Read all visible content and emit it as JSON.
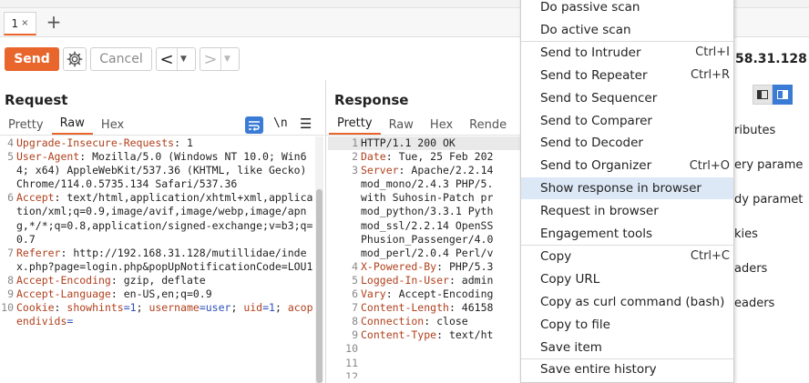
{
  "tabs": {
    "first_label": "1",
    "close_glyph": "×",
    "add_glyph": "+"
  },
  "toolbar": {
    "send_label": "Send",
    "cancel_label": "Cancel",
    "back_glyph": "<",
    "forward_glyph": ">",
    "dropdown_glyph": "▼",
    "target_host": "58.31.128"
  },
  "request": {
    "title": "Request",
    "tabs": [
      "Pretty",
      "Raw",
      "Hex"
    ],
    "active_tab": "Raw",
    "newline_toggle_label": "\\n",
    "menu_glyph": "☰",
    "lines": [
      {
        "num": "4",
        "key": "Upgrade-Insecure-Requests",
        "sep": ": ",
        "value": "1"
      },
      {
        "num": "5",
        "key": "User-Agent",
        "sep": ": ",
        "value": "Mozilla/5.0 (Windows NT 10.0; Win64; x64) AppleWebKit/537.36 (KHTML, like Gecko) Chrome/114.0.5735.134 Safari/537.36"
      },
      {
        "num": "6",
        "key": "Accept",
        "sep": ": ",
        "value": "text/html,application/xhtml+xml,application/xml;q=0.9,image/avif,image/webp,image/apng,*/*;q=0.8,application/signed-exchange;v=b3;q=0.7"
      },
      {
        "num": "7",
        "key": "Referer",
        "sep": ": ",
        "value": "http://192.168.31.128/mutillidae/index.php?page=login.php&popUpNotificationCode=LOU1"
      },
      {
        "num": "8",
        "key": "Accept-Encoding",
        "sep": ": ",
        "value": "gzip, deflate"
      },
      {
        "num": "9",
        "key": "Accept-Language",
        "sep": ": ",
        "value": "en-US,en;q=0.9"
      },
      {
        "num": "10",
        "key": "Cookie",
        "sep": ": ",
        "value": "showhints=1; username=user; uid=1; acopendivids="
      }
    ]
  },
  "response": {
    "title": "Response",
    "tabs": [
      "Pretty",
      "Raw",
      "Hex",
      "Rende"
    ],
    "active_tab": "Pretty",
    "lines": [
      {
        "num": "1",
        "text": "HTTP/1.1 200 OK",
        "plain": true
      },
      {
        "num": "2",
        "key": "Date",
        "sep": ": ",
        "value": "Tue, 25 Feb 202"
      },
      {
        "num": "3",
        "key": "Server",
        "sep": ": ",
        "value": "Apache/2.2.14"
      },
      {
        "num": "",
        "text": "mod_mono/2.4.3 PHP/5.",
        "plain": true
      },
      {
        "num": "",
        "text": "with Suhosin-Patch pr",
        "plain": true
      },
      {
        "num": "",
        "text": "mod_python/3.3.1 Pyth",
        "plain": true
      },
      {
        "num": "",
        "text": "mod_ssl/2.2.14 OpenSS",
        "plain": true
      },
      {
        "num": "",
        "text": "Phusion_Passenger/4.0",
        "plain": true
      },
      {
        "num": "",
        "text": "mod_perl/2.0.4 Perl/v",
        "plain": true
      },
      {
        "num": "4",
        "key": "X-Powered-By",
        "sep": ": ",
        "value": "PHP/5.3"
      },
      {
        "num": "5",
        "key": "Logged-In-User",
        "sep": ": ",
        "value": "admin"
      },
      {
        "num": "6",
        "key": "Vary",
        "sep": ": ",
        "value": "Accept-Encoding"
      },
      {
        "num": "7",
        "key": "Content-Length",
        "sep": ": ",
        "value": "46158"
      },
      {
        "num": "8",
        "key": "Connection",
        "sep": ": ",
        "value": "close"
      },
      {
        "num": "9",
        "key": "Content-Type",
        "sep": ": ",
        "value": "text/ht"
      },
      {
        "num": "10",
        "text": "",
        "plain": true
      },
      {
        "num": "11",
        "text": "",
        "plain": true
      },
      {
        "num": "12",
        "text": "",
        "plain": true
      }
    ]
  },
  "inspector": {
    "rows": [
      "ributes",
      "ery parame",
      "dy paramet",
      "kies",
      "aders",
      "eaders"
    ]
  },
  "context_menu": {
    "items": [
      {
        "label": "Do passive scan",
        "shortcut": ""
      },
      {
        "label": "Do active scan",
        "shortcut": ""
      },
      {
        "label": "Send to Intruder",
        "shortcut": "Ctrl+I"
      },
      {
        "label": "Send to Repeater",
        "shortcut": "Ctrl+R"
      },
      {
        "label": "Send to Sequencer",
        "shortcut": ""
      },
      {
        "label": "Send to Comparer",
        "shortcut": ""
      },
      {
        "label": "Send to Decoder",
        "shortcut": ""
      },
      {
        "label": "Send to Organizer",
        "shortcut": "Ctrl+O"
      },
      {
        "label": "Show response in browser",
        "shortcut": "",
        "selected": true
      },
      {
        "label": "Request in browser",
        "shortcut": ""
      },
      {
        "label": "Engagement tools",
        "shortcut": ""
      },
      {
        "label": "Copy",
        "shortcut": "Ctrl+C"
      },
      {
        "label": "Copy URL",
        "shortcut": ""
      },
      {
        "label": "Copy as curl command (bash)",
        "shortcut": ""
      },
      {
        "label": "Copy to file",
        "shortcut": ""
      },
      {
        "label": "Save item",
        "shortcut": ""
      },
      {
        "label": "Save entire history",
        "shortcut": ""
      }
    ]
  },
  "colors": {
    "accent": "#e8662c",
    "header_key": "#b0401c",
    "selected_menu": "#dce8f6",
    "toggle_blue": "#3a7bd5"
  }
}
